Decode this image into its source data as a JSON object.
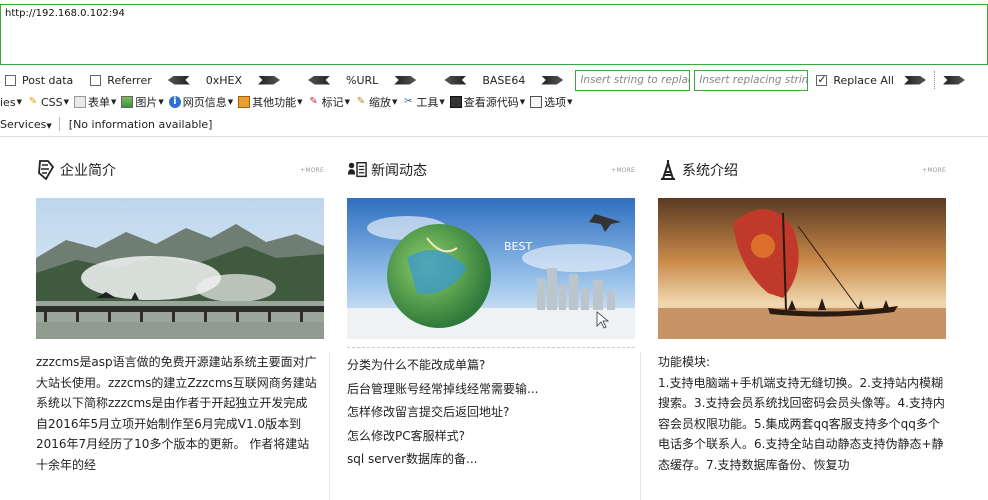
{
  "hackbar": {
    "url": "http://192.168.0.102:94",
    "post_data_label": "Post data",
    "referrer_label": "Referrer",
    "hex_label": "0xHEX",
    "url_label": "%URL",
    "base64_label": "BASE64",
    "replace_placeholder": "Insert string to replace",
    "replacing_placeholder": "Insert replacing string",
    "replace_all_label": "Replace All"
  },
  "toolbar": {
    "items": [
      "ies",
      "CSS",
      "表单",
      "图片",
      "网页信息",
      "其他功能",
      "标记",
      "缩放",
      "工具",
      "查看源代码",
      "选项"
    ]
  },
  "statusbar": {
    "services": "Services",
    "info": "[No information available]"
  },
  "columns": [
    {
      "title": "企业简介",
      "more": "+MORE",
      "body": "zzzcms是asp语言做的免费开源建站系统主要面对广大站长使用。zzzcms的建立Zzzcms互联网商务建站系统以下简称zzzcms是由作者于开起独立开发完成自2016年5月立项开始制作至6月完成V1.0版本到2016年7月经历了10多个版本的更新。   作者将建站十余年的经"
    },
    {
      "title": "新闻动态",
      "more": "+MORE",
      "banner_text": "BEST",
      "news": [
        "分类为什么不能改成单篇?",
        "后台管理账号经常掉线经常需要输...",
        "怎样修改留言提交后返回地址?",
        "怎么修改PC客服样式?",
        "sql server数据库的备..."
      ]
    },
    {
      "title": "系统介绍",
      "more": "+MORE",
      "body": "功能模块:\n1.支持电脑端+手机端支持无缝切换。2.支持站内模糊搜索。3.支持会员系统找回密码会员头像等。4.支持内容会员权限功能。5.集成两套qq客服支持多个qq多个电话多个联系人。6.支持全站自动静态支持伪静态+静态缓存。7.支持数据库备份、恢复功"
    }
  ]
}
